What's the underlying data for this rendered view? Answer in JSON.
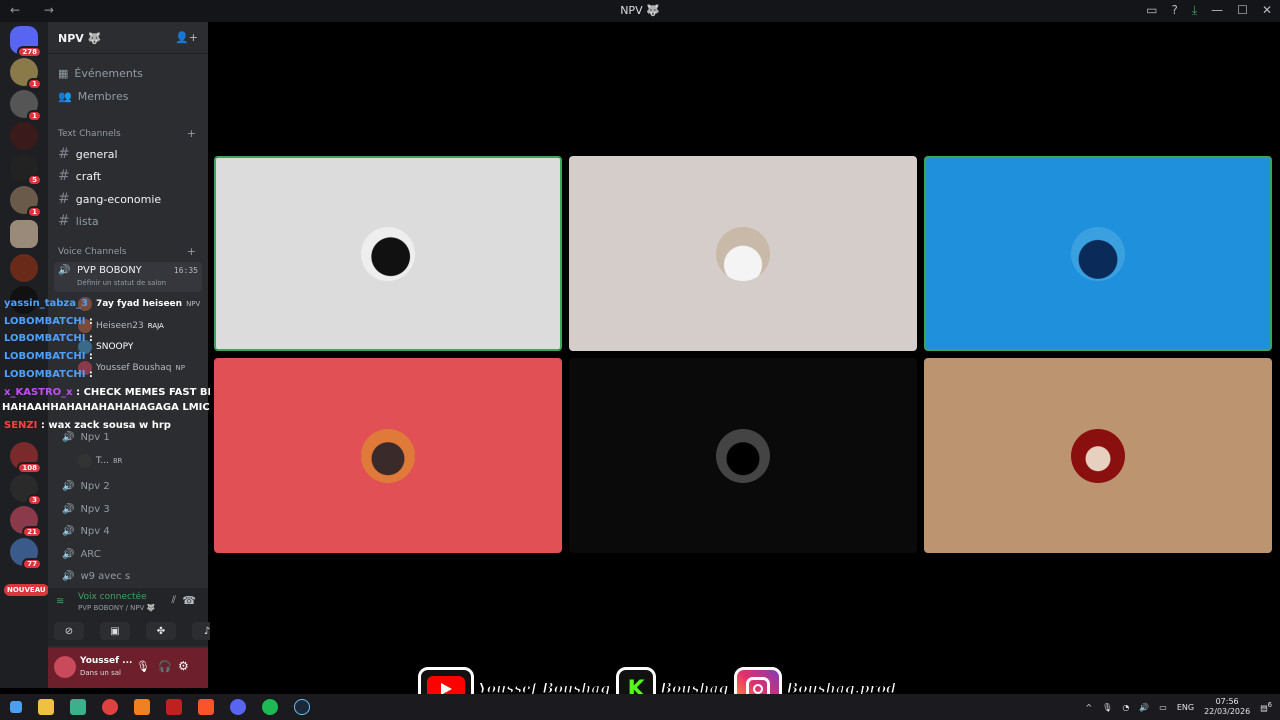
{
  "window": {
    "title": "NPV 🐺"
  },
  "guilds": {
    "home_badge": "278",
    "badges": [
      "1",
      "1",
      "",
      "5",
      "1",
      "1",
      "",
      "",
      "4",
      "",
      "",
      "108",
      "3",
      "21",
      "77"
    ],
    "nouveau": "NOUVEAU"
  },
  "server": {
    "name": "NPV 🐺"
  },
  "nav": {
    "events": "Événements",
    "members": "Membres"
  },
  "text_category": "Text Channels",
  "text_channels": [
    "general",
    "craft",
    "gang-economie",
    "lista"
  ],
  "voice_category": "Voice Channels",
  "active_voice": {
    "name": "PVP BOBONY",
    "time": "16:35",
    "status": "Définir un statut de salon"
  },
  "voice_users": [
    {
      "name": "7ay fyad heiseen",
      "tag": "NPV"
    },
    {
      "name": "Heiseen23",
      "tag": "RAJA"
    },
    {
      "name": "SNOOPY",
      "tag": ""
    },
    {
      "name": "Youssef Boushaq",
      "tag": "NP"
    }
  ],
  "npv1": {
    "name": "Npv 1",
    "user": "T...",
    "tag": "8R"
  },
  "voice_channels": [
    "Npv 2",
    "Npv 3",
    "Npv 4",
    "ARC",
    "w9 avec s"
  ],
  "chat_overlay": [
    {
      "name": "yassin_tabza_3",
      "text": ""
    },
    {
      "name": "LOBOMBATCHI",
      "text": ":"
    },
    {
      "name": "LOBOMBATCHI",
      "text": ":"
    },
    {
      "name": "LOBOMBATCHI",
      "text": ":"
    },
    {
      "name": "LOBOMBATCHI",
      "text": ":"
    },
    {
      "name": "x_KASTRO_x",
      "text": ": CHECK MEMES FAST BROJOLA"
    },
    {
      "name": "",
      "text": "HAHAAHHAHAHAHAHAHAGAGA LMIC BACH KAYDWI HEISEN DABA"
    },
    {
      "name": "SENZI",
      "text": ": wax zack sousa w hrp"
    }
  ],
  "voice_status": {
    "label": "Voix connectée",
    "sub": "PVP BOBONY / NPV 🐺"
  },
  "user": {
    "name": "Youssef ...",
    "status": "Dans un sal"
  },
  "banner": {
    "youtube": "Youssef Boushaq",
    "kick": "Boushaq",
    "instagram": "Boushaq.prod"
  },
  "tray": {
    "lang": "ENG",
    "time": "07:56",
    "date": "22/03/2026",
    "notif": "6"
  },
  "colors": {
    "tile1": "#dcdcdc",
    "tile2": "#d5cdca",
    "tile3": "#1e90dc",
    "tile4": "#e05055",
    "tile5": "#0a0a0a",
    "tile6": "#bd9470",
    "speaking": "#3ba55d"
  }
}
